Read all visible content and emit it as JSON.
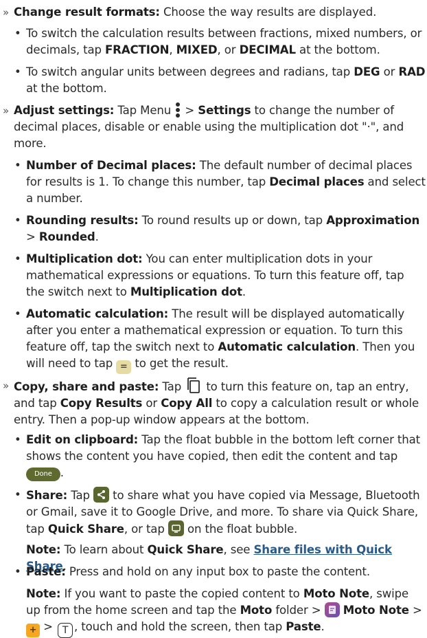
{
  "sections": {
    "format": {
      "marker": "»",
      "title": "Change result formats:",
      "text": " Choose the way results are displayed.",
      "b1": {
        "t1": "To switch the calculation results between fractions, mixed numbers, or decimals, tap ",
        "fraction": "FRACTION",
        "comma": ", ",
        "mixed": "MIXED",
        "t2": ", or ",
        "decimal": "DECIMAL",
        "t3": " at the bottom."
      },
      "b2": {
        "t1": "To switch angular units between degrees and radians, tap ",
        "deg": "DEG",
        "or": " or ",
        "rad": "RAD",
        "t2": " at the bottom."
      }
    },
    "settings": {
      "marker": "»",
      "title": "Adjust settings:",
      "t1": " Tap Menu ",
      "gt": " > ",
      "settings": "Settings",
      "t2": " to change the number of decimal places, disable or enable using the multiplication dot \"·\", and more.",
      "decimal": {
        "title": "Number of Decimal places:",
        "t1": " The default number of decimal places for results is 1. To change this number, tap ",
        "key": "Decimal places",
        "t2": " and select a number."
      },
      "rounding": {
        "title": "Rounding results:",
        "t1": " To round results up or down, tap ",
        "key1": "Approximation",
        "gt": " > ",
        "key2": "Rounded",
        "t2": "."
      },
      "dot": {
        "title": "Multiplication dot:",
        "t1": " You can enter multiplication dots in your mathematical expressions or equations. To turn this feature off, tap the switch next to ",
        "key": "Multiplication dot",
        "t2": "."
      },
      "auto": {
        "title": "Automatic calculation:",
        "t1": " The result will be displayed automatically after you enter a mathematical expression or equation. To turn this feature off, tap the switch next to ",
        "key": "Automatic calculation",
        "t2": ". Then you will need to tap ",
        "eq": "=",
        "t3": " to get the result."
      }
    },
    "copy": {
      "marker": "»",
      "title": "Copy, share and paste:",
      "t1": " Tap ",
      "t2": " to turn this feature on, tap an entry, and tap ",
      "key1": "Copy Results",
      "or": " or ",
      "key2": "Copy All",
      "t3": " to copy a calculation result or whole entry. Then a pop-up window appears at the bottom.",
      "edit": {
        "title": "Edit on clipboard:",
        "t1": " Tap the float bubble in the bottom left corner that shows the content you have copied, then edit the content and tap ",
        "done": "Done",
        "t2": "."
      },
      "share": {
        "title": "Share:",
        "t1": " Tap ",
        "t2": " to share what you have copied via Message, Bluetooth or Gmail, save it to Google Drive, and more. To share via Quick Share, tap ",
        "key": "Quick Share",
        "t3": ", or tap ",
        "t4": " on the float bubble."
      },
      "note1": {
        "label": "Note:",
        "t1": " To learn about ",
        "key": "Quick Share",
        "t2": ", see ",
        "link": "Share files with Quick Share",
        "t3": "."
      },
      "paste": {
        "title": "Paste:",
        "t1": " Press and hold on any input box to paste the content."
      },
      "note2": {
        "label": "Note:",
        "t1": " If you want to paste the copied content to ",
        "key1": "Moto Note",
        "t2": ", swipe up from the home screen and tap the ",
        "key2": "Moto",
        "t3": " folder > ",
        "key3": "Moto Note",
        "t4": " > ",
        "plus": "+",
        "t5": " > ",
        "tglyph": "T",
        "t6": ", touch and hold the screen, then tap ",
        "key4": "Paste",
        "t7": "."
      }
    }
  },
  "icons": [
    "menu-dots-icon",
    "copy-mode-icon",
    "share-icon",
    "float-bubble-icon",
    "moto-note-app-icon"
  ],
  "colors": {
    "text": "#2b2b2b",
    "link": "#2a5a8a",
    "equals_button": "#e6dba2",
    "done_button": "#5e6a2f",
    "plus_button": "#f5a623"
  }
}
